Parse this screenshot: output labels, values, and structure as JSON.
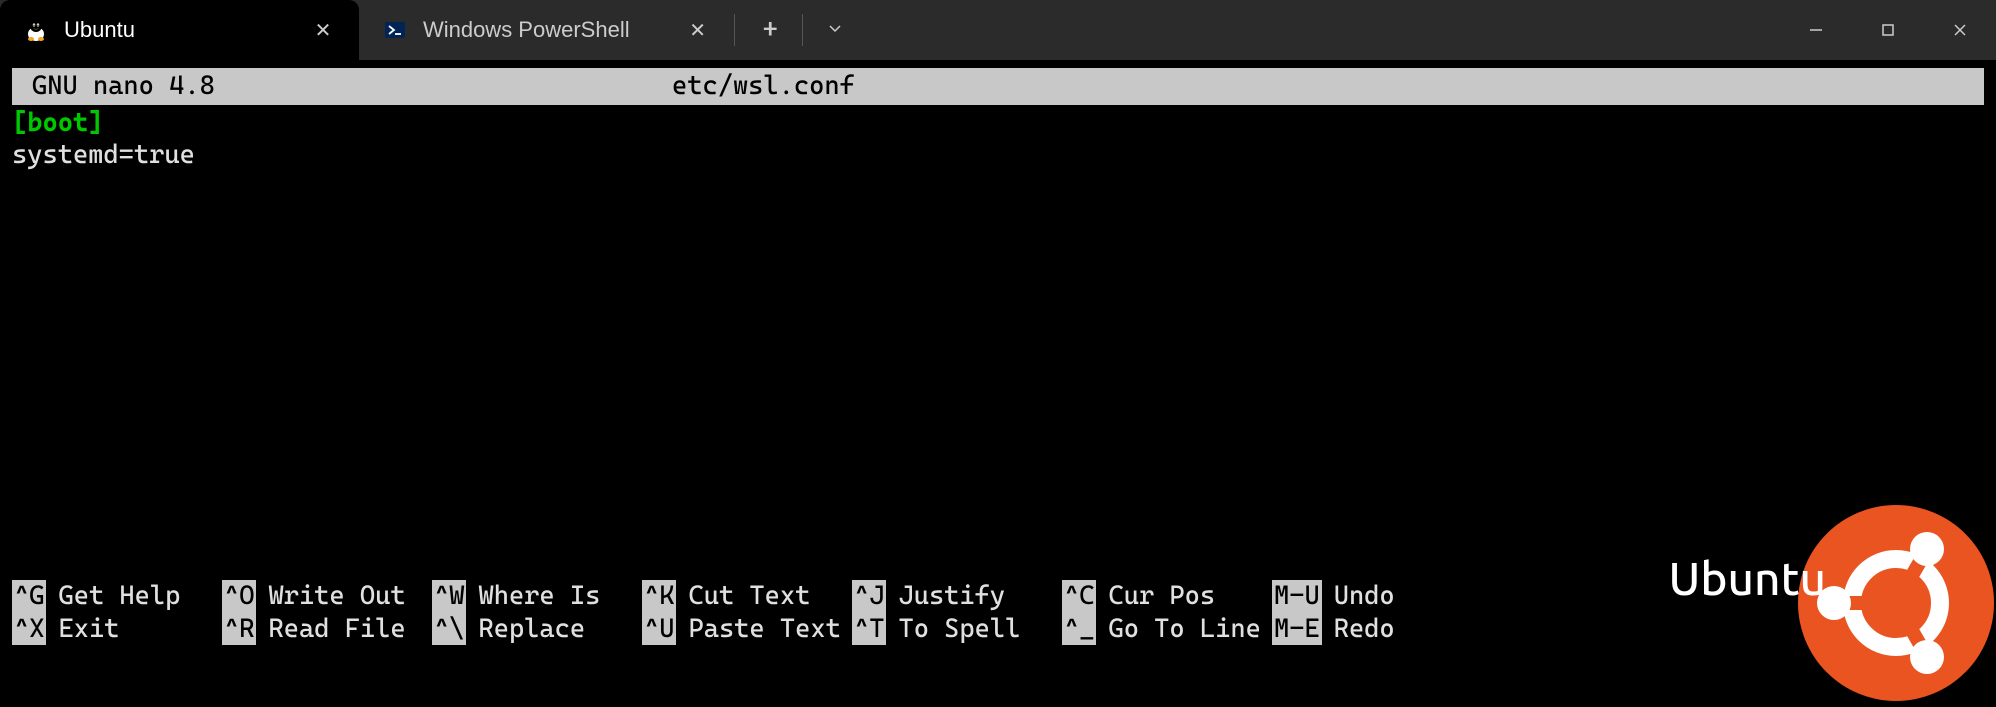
{
  "titlebar": {
    "tabs": [
      {
        "label": "Ubuntu",
        "active": true,
        "icon": "tux-icon"
      },
      {
        "label": "Windows PowerShell",
        "active": false,
        "icon": "powershell-icon"
      }
    ]
  },
  "nano": {
    "app_name": "GNU nano 4.8",
    "file_path": "etc/wsl.conf",
    "content_section": "[boot]",
    "content_line": "systemd=true",
    "commands_row1": [
      {
        "key": "^G",
        "label": "Get Help"
      },
      {
        "key": "^O",
        "label": "Write Out"
      },
      {
        "key": "^W",
        "label": "Where Is"
      },
      {
        "key": "^K",
        "label": "Cut Text"
      },
      {
        "key": "^J",
        "label": "Justify"
      },
      {
        "key": "^C",
        "label": "Cur Pos"
      },
      {
        "key": "M-U",
        "label": "Undo"
      }
    ],
    "commands_row2": [
      {
        "key": "^X",
        "label": "Exit"
      },
      {
        "key": "^R",
        "label": "Read File"
      },
      {
        "key": "^\\",
        "label": "Replace"
      },
      {
        "key": "^U",
        "label": "Paste Text"
      },
      {
        "key": "^T",
        "label": "To Spell"
      },
      {
        "key": "^_",
        "label": "Go To Line"
      },
      {
        "key": "M-E",
        "label": "Redo"
      }
    ]
  },
  "watermark": {
    "text": "Ubuntu"
  }
}
